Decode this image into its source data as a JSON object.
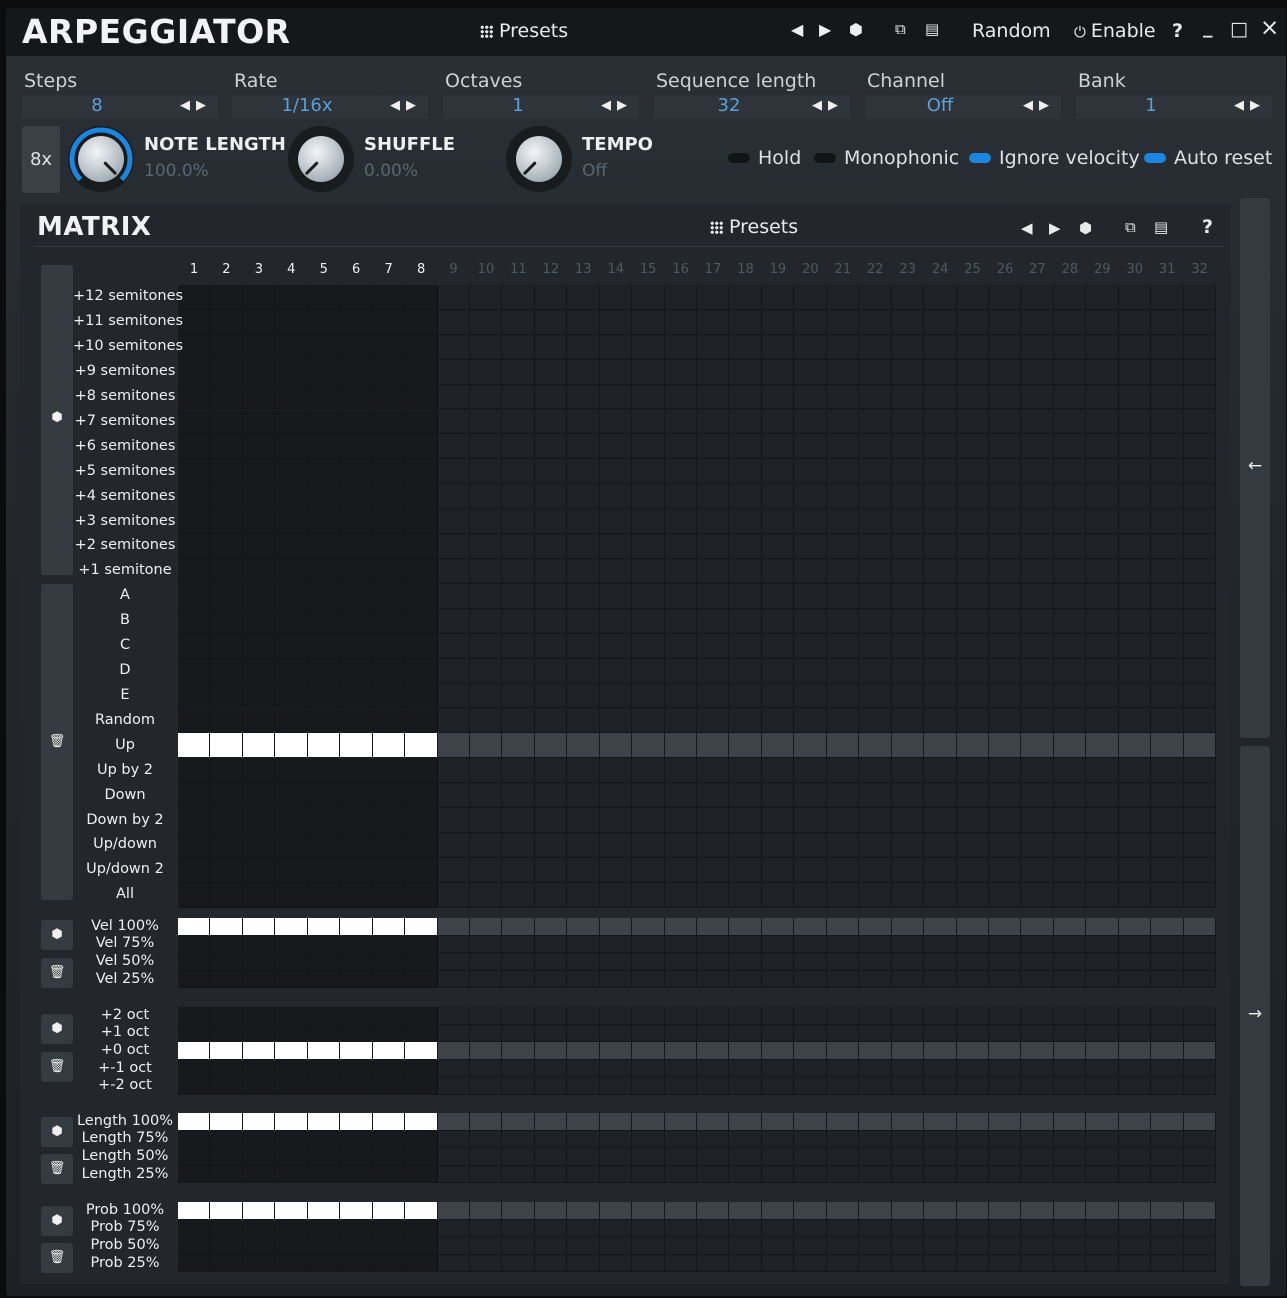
{
  "title": "ARPEGGIATOR",
  "titlebar": {
    "presets_label": "Presets",
    "prev_icon": "triangle-left-icon",
    "next_icon": "triangle-right-icon",
    "random_icon": "dice-icon",
    "copy_icon": "copy-icon",
    "paste_icon": "paste-icon",
    "random_label": "Random",
    "enable_label": "Enable",
    "help_label": "?",
    "minimize_label": "_",
    "maximize_label": "□",
    "close_label": "×"
  },
  "params": [
    {
      "label": "Steps",
      "value": "8"
    },
    {
      "label": "Rate",
      "value": "1/16x"
    },
    {
      "label": "Octaves",
      "value": "1"
    },
    {
      "label": "Sequence length",
      "value": "32"
    },
    {
      "label": "Channel",
      "value": "Off"
    },
    {
      "label": "Bank",
      "value": "1"
    }
  ],
  "multiplier_label": "8x",
  "knobs": [
    {
      "label": "NOTE LENGTH",
      "value": "100.0%",
      "level": 1.0
    },
    {
      "label": "SHUFFLE",
      "value": "0.00%",
      "level": 0.0
    },
    {
      "label": "TEMPO",
      "value": "Off",
      "level": 0.0
    }
  ],
  "toggles": [
    {
      "label": "Hold",
      "on": false
    },
    {
      "label": "Monophonic",
      "on": false
    },
    {
      "label": "Ignore velocity",
      "on": true
    },
    {
      "label": "Auto reset",
      "on": true
    }
  ],
  "colors": {
    "accent": "#1a86e0",
    "inactive_value": "#5aa0d9",
    "toggle_off": "#121416"
  },
  "matrix": {
    "title": "MATRIX",
    "presets_label": "Presets",
    "help_label": "?",
    "columns": [
      "1",
      "2",
      "3",
      "4",
      "5",
      "6",
      "7",
      "8",
      "9",
      "10",
      "11",
      "12",
      "13",
      "14",
      "15",
      "16",
      "17",
      "18",
      "19",
      "20",
      "21",
      "22",
      "23",
      "24",
      "25",
      "26",
      "27",
      "28",
      "29",
      "30",
      "31",
      "32"
    ],
    "active_steps": 8,
    "semitone_rows": [
      "+12 semitones",
      "+11 semitones",
      "+10 semitones",
      "+9 semitones",
      "+8 semitones",
      "+7 semitones",
      "+6 semitones",
      "+5 semitones",
      "+4 semitones",
      "+3 semitones",
      "+2 semitones",
      "+1 semitone"
    ],
    "mode_rows": [
      "A",
      "B",
      "C",
      "D",
      "E",
      "Random",
      "Up",
      "Up by 2",
      "Down",
      "Down by 2",
      "Up/down",
      "Up/down 2",
      "All"
    ],
    "mode_selected": "Up",
    "velocity_rows": [
      "Vel 100%",
      "Vel 75%",
      "Vel 50%",
      "Vel 25%"
    ],
    "velocity_selected": "Vel 100%",
    "octave_rows": [
      "+2 oct",
      "+1 oct",
      "+0 oct",
      "+-1 oct",
      "+-2 oct"
    ],
    "octave_selected": "+0 oct",
    "length_rows": [
      "Length 100%",
      "Length 75%",
      "Length 50%",
      "Length 25%"
    ],
    "length_selected": "Length 100%",
    "prob_rows": [
      "Prob 100%",
      "Prob 75%",
      "Prob 50%",
      "Prob 25%"
    ],
    "prob_selected": "Prob 100%"
  }
}
